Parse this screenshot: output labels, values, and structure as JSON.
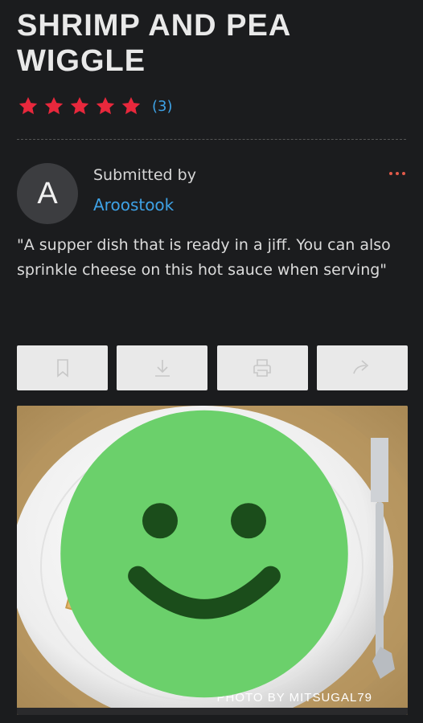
{
  "recipe": {
    "title": "SHRIMP AND PEA WIGGLE",
    "rating_value": 5,
    "rating_max": 5,
    "rating_count": "(3)",
    "submitted_label": "Submitted by",
    "author": "Aroostook",
    "author_initial": "A",
    "description": "\"A supper dish that is ready in a jiff. You can also sprinkle cheese on this hot sauce when serving\""
  },
  "actions": [
    {
      "name": "save",
      "icon": "bookmark-icon"
    },
    {
      "name": "download",
      "icon": "download-icon"
    },
    {
      "name": "print",
      "icon": "printer-icon"
    },
    {
      "name": "share",
      "icon": "share-arrow-icon"
    }
  ],
  "photo": {
    "credit": "PHOTO BY MITSUGAL79",
    "credit_icon": "smiley-icon"
  },
  "colors": {
    "background": "#1b1c1e",
    "accent_blue": "#3ea2e6",
    "star_red": "#e8283c",
    "button_bg": "#e9e9e9",
    "smiley_green": "#6bd06b"
  }
}
